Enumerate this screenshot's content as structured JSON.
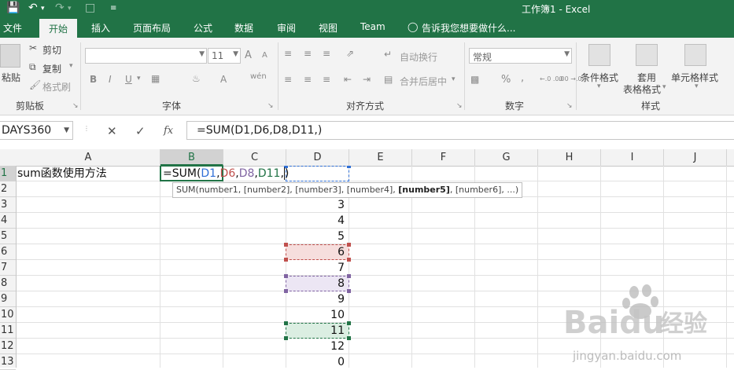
{
  "window": {
    "title": "工作簿1 - Excel"
  },
  "tabs": [
    "文件",
    "开始",
    "插入",
    "页面布局",
    "公式",
    "数据",
    "审阅",
    "视图",
    "Team",
    "告诉我您想要做什么..."
  ],
  "ribbon": {
    "clipboard": {
      "paste": "粘贴",
      "cut": "剪切",
      "copy": "复制",
      "format_painter": "格式刷",
      "label": "剪贴板"
    },
    "font": {
      "name": "",
      "size": "11",
      "label": "字体",
      "bold": "B",
      "italic": "I",
      "underline": "U",
      "grow": "A",
      "shrink": "A",
      "color": "A",
      "phonetic": "wén"
    },
    "alignment": {
      "wrap": "自动换行",
      "merge": "合并后居中",
      "label": "对齐方式"
    },
    "number": {
      "format": "常规",
      "label": "数字",
      "percent": "%",
      "comma": ",",
      "inc_decimal": "←.0 .00",
      "dec_decimal": ".00 →.0"
    },
    "styles": {
      "conditional": "条件格式",
      "table_line1": "套用",
      "table_line2": "表格格式",
      "cell_styles": "单元格样式",
      "label": "样式"
    }
  },
  "formula_bar": {
    "name_box": "DAYS360",
    "fx": "fx",
    "formula": "=SUM(D1,D6,D8,D11,)"
  },
  "sheet": {
    "columns": [
      "A",
      "B",
      "C",
      "D",
      "E",
      "F",
      "G",
      "H",
      "I",
      "J"
    ],
    "rows": [
      "1",
      "2",
      "3",
      "4",
      "5",
      "6",
      "7",
      "8",
      "9",
      "10",
      "11",
      "12",
      "13"
    ],
    "a1": "sum函数使用方法",
    "b1": {
      "p1": "=SUM(",
      "r1": "D1",
      "c1": ",",
      "r2": "D6",
      "c2": ",",
      "r3": "D8",
      "c3": ",",
      "r4": "D11",
      "c4": ",",
      "p2": ")"
    },
    "d_values": [
      "",
      "",
      "3",
      "4",
      "5",
      "6",
      "7",
      "8",
      "9",
      "10",
      "11",
      "12",
      "0"
    ],
    "tooltip": {
      "t1": "SUM(number1, [number2], [number3], [number4], ",
      "bold": "[number5]",
      "t2": ", [number6], ...)"
    }
  },
  "colors": {
    "brand": "#217346",
    "ref_d1": "#2f6fd6",
    "ref_d6": "#c0504d",
    "ref_d8": "#8064a2",
    "ref_d11": "#217346"
  },
  "watermark": {
    "brand": "Baidu",
    "cn": "经验",
    "url": "jingyan.baidu.com"
  }
}
